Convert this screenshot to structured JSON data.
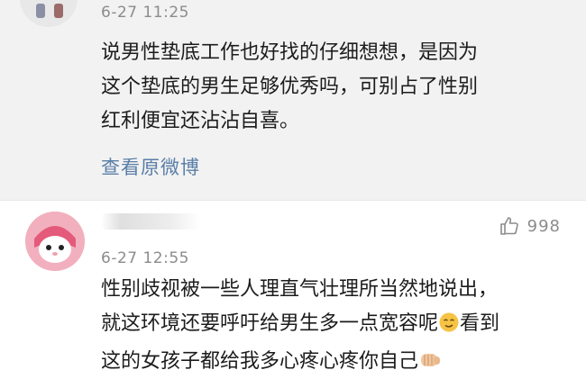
{
  "comments": [
    {
      "time": "6-27 11:25",
      "lines": [
        "说男性垫底工作也好找的仔细想想，是因为",
        "这个垫底的男生足够优秀吗，可别占了性别",
        "红利便宜还沾沾自喜。"
      ],
      "link": "查看原微博"
    },
    {
      "time": "6-27 12:55",
      "likes": "998",
      "lines": [
        "性别歧视被一些人理直气壮理所当然地说出，",
        "就这环境还要呼吁给男生多一点宽容呢",
        "看到",
        "这的女孩子都给我多心疼心疼你自己"
      ]
    }
  ],
  "icons": [
    "thumbs-up-icon",
    "smirk-emoji-icon",
    "fist-emoji-icon"
  ]
}
